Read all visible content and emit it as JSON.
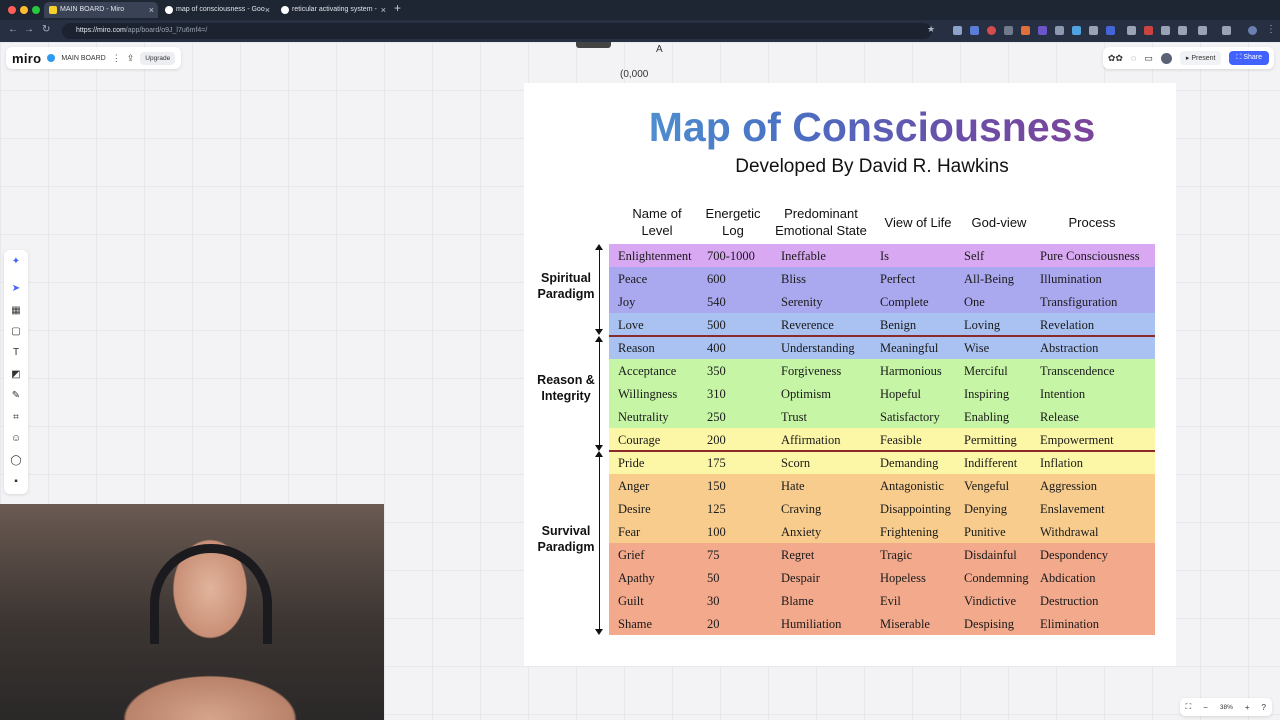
{
  "browser": {
    "tabs": [
      {
        "title": "MAIN BOARD - Miro",
        "active": true
      },
      {
        "title": "map of consciousness - Goo",
        "active": false
      },
      {
        "title": "reticular activating system - ",
        "active": false
      }
    ],
    "url_host": "https://miro.com",
    "url_path": "/app/board/o9J_l7u6mf4=/"
  },
  "miro": {
    "logo": "miro",
    "board_name": "MAIN BOARD",
    "upgrade_label": "Upgrade",
    "present_label": "Present",
    "share_label": "Share",
    "zoom": "38%",
    "scribble_top": "A",
    "scribble_number": "(0,000"
  },
  "card": {
    "title": "Map of Consciousness",
    "subtitle": "Developed By David R. Hawkins",
    "headers": [
      "Name of Level",
      "Energetic Log",
      "Predominant Emotional State",
      "View of Life",
      "God-view",
      "Process"
    ],
    "paradigms": [
      "Spiritual Paradigm",
      "Reason & Integrity",
      "Survival Paradigm"
    ],
    "rows": [
      {
        "level": "Enlightenment",
        "log": "700-1000",
        "emotion": "Ineffable",
        "view": "Is",
        "god": "Self",
        "process": "Pure Consciousness",
        "color": "#d9a8f2"
      },
      {
        "level": "Peace",
        "log": "600",
        "emotion": "Bliss",
        "view": "Perfect",
        "god": "All-Being",
        "process": "Illumination",
        "color": "#aaa8ee"
      },
      {
        "level": "Joy",
        "log": "540",
        "emotion": "Serenity",
        "view": "Complete",
        "god": "One",
        "process": "Transfiguration",
        "color": "#aaa8ee"
      },
      {
        "level": "Love",
        "log": "500",
        "emotion": "Reverence",
        "view": "Benign",
        "god": "Loving",
        "process": "Revelation",
        "color": "#a9c2f2"
      },
      {
        "level": "Reason",
        "log": "400",
        "emotion": "Understanding",
        "view": "Meaningful",
        "god": "Wise",
        "process": "Abstraction",
        "color": "#a9c2f2"
      },
      {
        "level": "Acceptance",
        "log": "350",
        "emotion": "Forgiveness",
        "view": "Harmonious",
        "god": "Merciful",
        "process": "Transcendence",
        "color": "#c6f5a6"
      },
      {
        "level": "Willingness",
        "log": "310",
        "emotion": "Optimism",
        "view": "Hopeful",
        "god": "Inspiring",
        "process": "Intention",
        "color": "#c6f5a6"
      },
      {
        "level": "Neutrality",
        "log": "250",
        "emotion": "Trust",
        "view": "Satisfactory",
        "god": "Enabling",
        "process": "Release",
        "color": "#c6f5a6"
      },
      {
        "level": "Courage",
        "log": "200",
        "emotion": "Affirmation",
        "view": "Feasible",
        "god": "Permitting",
        "process": "Empowerment",
        "color": "#fcf7a6"
      },
      {
        "level": "Pride",
        "log": "175",
        "emotion": "Scorn",
        "view": "Demanding",
        "god": "Indifferent",
        "process": "Inflation",
        "color": "#fcf7a6"
      },
      {
        "level": "Anger",
        "log": "150",
        "emotion": "Hate",
        "view": "Antagonistic",
        "god": "Vengeful",
        "process": "Aggression",
        "color": "#f7cc8d"
      },
      {
        "level": "Desire",
        "log": "125",
        "emotion": "Craving",
        "view": "Disappointing",
        "god": "Denying",
        "process": "Enslavement",
        "color": "#f7cc8d"
      },
      {
        "level": "Fear",
        "log": "100",
        "emotion": "Anxiety",
        "view": "Frightening",
        "god": "Punitive",
        "process": "Withdrawal",
        "color": "#f7cc8d"
      },
      {
        "level": "Grief",
        "log": "75",
        "emotion": "Regret",
        "view": "Tragic",
        "god": "Disdainful",
        "process": "Despondency",
        "color": "#f2a98c"
      },
      {
        "level": "Apathy",
        "log": "50",
        "emotion": "Despair",
        "view": "Hopeless",
        "god": "Condemning",
        "process": "Abdication",
        "color": "#f2a98c"
      },
      {
        "level": "Guilt",
        "log": "30",
        "emotion": "Blame",
        "view": "Evil",
        "god": "Vindictive",
        "process": "Destruction",
        "color": "#f2a98c"
      },
      {
        "level": "Shame",
        "log": "20",
        "emotion": "Humiliation",
        "view": "Miserable",
        "god": "Despising",
        "process": "Elimination",
        "color": "#f2a98c"
      }
    ]
  },
  "icons": {
    "back": "arrow-left-icon",
    "forward": "arrow-right-icon",
    "reload": "reload-icon",
    "star": "star-icon",
    "more": "more-vertical-icon",
    "export": "upload-icon"
  },
  "colors": {
    "share": "#4262ff",
    "divider": "#8b2a2a",
    "chrome": "#1f2633"
  }
}
